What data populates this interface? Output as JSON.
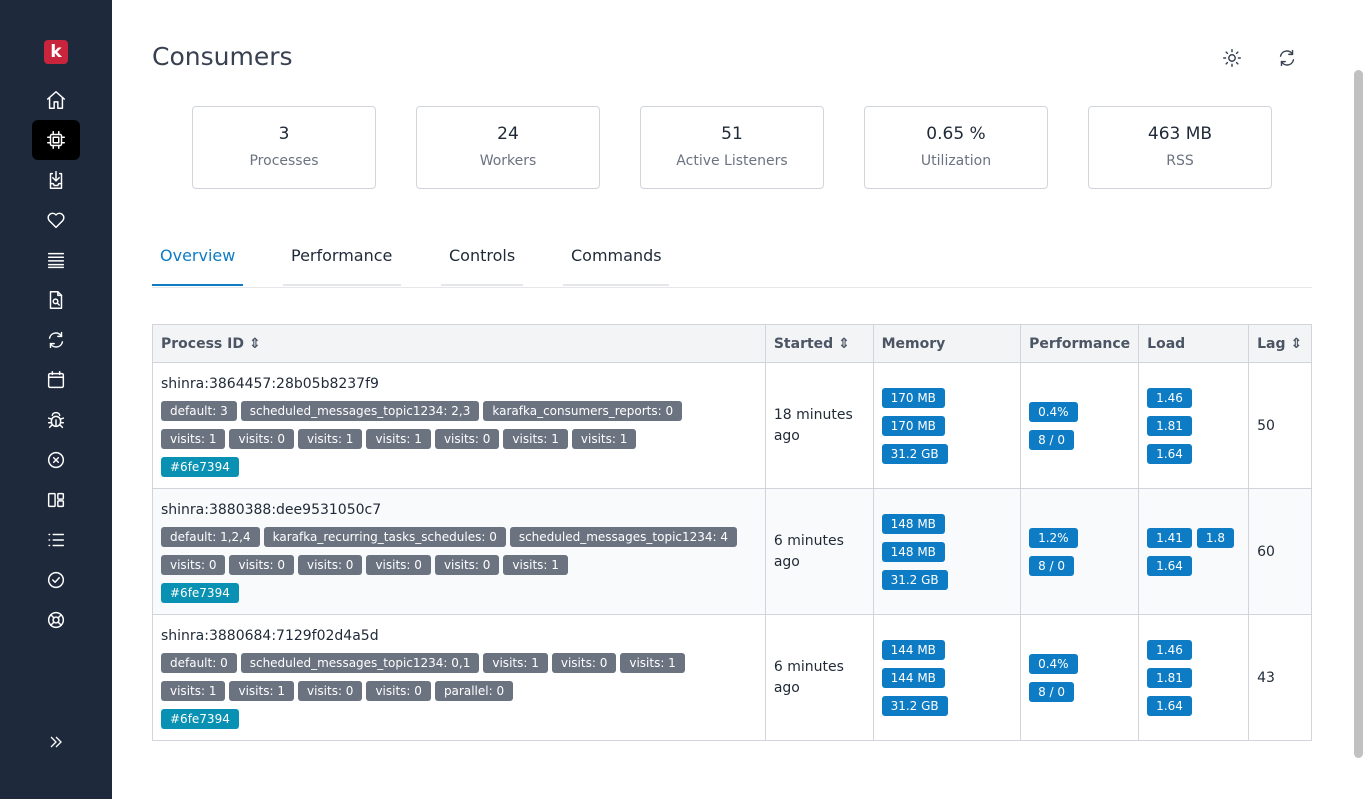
{
  "app": {
    "logo_letter": "k"
  },
  "sidebar": {
    "items": [
      {
        "name": "home",
        "active": false
      },
      {
        "name": "consumers",
        "active": true
      },
      {
        "name": "jobs",
        "active": false
      },
      {
        "name": "health",
        "active": false
      },
      {
        "name": "topics",
        "active": false
      },
      {
        "name": "explorer",
        "active": false
      },
      {
        "name": "recurring",
        "active": false
      },
      {
        "name": "scheduled",
        "active": false
      },
      {
        "name": "errors",
        "active": false
      },
      {
        "name": "dead",
        "active": false
      },
      {
        "name": "dashboard",
        "active": false
      },
      {
        "name": "list",
        "active": false
      },
      {
        "name": "status",
        "active": false
      },
      {
        "name": "support",
        "active": false
      }
    ]
  },
  "header": {
    "title": "Consumers"
  },
  "stats": [
    {
      "value": "3",
      "label": "Processes"
    },
    {
      "value": "24",
      "label": "Workers"
    },
    {
      "value": "51",
      "label": "Active Listeners"
    },
    {
      "value": "0.65 %",
      "label": "Utilization"
    },
    {
      "value": "463 MB",
      "label": "RSS"
    }
  ],
  "tabs": [
    {
      "label": "Overview",
      "active": true
    },
    {
      "label": "Performance",
      "active": false
    },
    {
      "label": "Controls",
      "active": false
    },
    {
      "label": "Commands",
      "active": false
    }
  ],
  "table": {
    "columns": [
      "Process ID ⇕",
      "Started ⇕",
      "Memory",
      "Performance",
      "Load",
      "Lag ⇕"
    ],
    "rows": [
      {
        "pid": "shinra:3864457:28b05b8237f9",
        "badges_line1": [
          "default: 3",
          "scheduled_messages_topic1234: 2,3",
          "karafka_consumers_reports: 0"
        ],
        "badges_line2": [
          "visits: 1",
          "visits: 0",
          "visits: 1",
          "visits: 1",
          "visits: 0",
          "visits: 1",
          "visits: 1"
        ],
        "tag": "#6fe7394",
        "started_1": "18 minutes",
        "started_2": "ago",
        "memory": [
          "170 MB",
          "170 MB",
          "31.2 GB"
        ],
        "performance": [
          "0.4%",
          "8 / 0"
        ],
        "load": [
          [
            "1.46"
          ],
          [
            "1.81"
          ],
          [
            "1.64"
          ]
        ],
        "lag": "50"
      },
      {
        "pid": "shinra:3880388:dee9531050c7",
        "badges_line1": [
          "default: 1,2,4",
          "karafka_recurring_tasks_schedules: 0",
          "scheduled_messages_topic1234: 4"
        ],
        "badges_line2": [
          "visits: 0",
          "visits: 0",
          "visits: 0",
          "visits: 0",
          "visits: 0",
          "visits: 1"
        ],
        "tag": "#6fe7394",
        "started_1": "6 minutes",
        "started_2": "ago",
        "memory": [
          "148 MB",
          "148 MB",
          "31.2 GB"
        ],
        "performance": [
          "1.2%",
          "8 / 0"
        ],
        "load": [
          [
            "1.41",
            "1.8"
          ],
          [
            "1.64"
          ]
        ],
        "lag": "60"
      },
      {
        "pid": "shinra:3880684:7129f02d4a5d",
        "badges_line1": [
          "default: 0",
          "scheduled_messages_topic1234: 0,1",
          "visits: 1",
          "visits: 0",
          "visits: 1"
        ],
        "badges_line2": [
          "visits: 1",
          "visits: 1",
          "visits: 0",
          "visits: 0",
          "parallel: 0"
        ],
        "tag": "#6fe7394",
        "started_1": "6 minutes",
        "started_2": "ago",
        "memory": [
          "144 MB",
          "144 MB",
          "31.2 GB"
        ],
        "performance": [
          "0.4%",
          "8 / 0"
        ],
        "load": [
          [
            "1.46"
          ],
          [
            "1.81"
          ],
          [
            "1.64"
          ]
        ],
        "lag": "43"
      }
    ]
  }
}
